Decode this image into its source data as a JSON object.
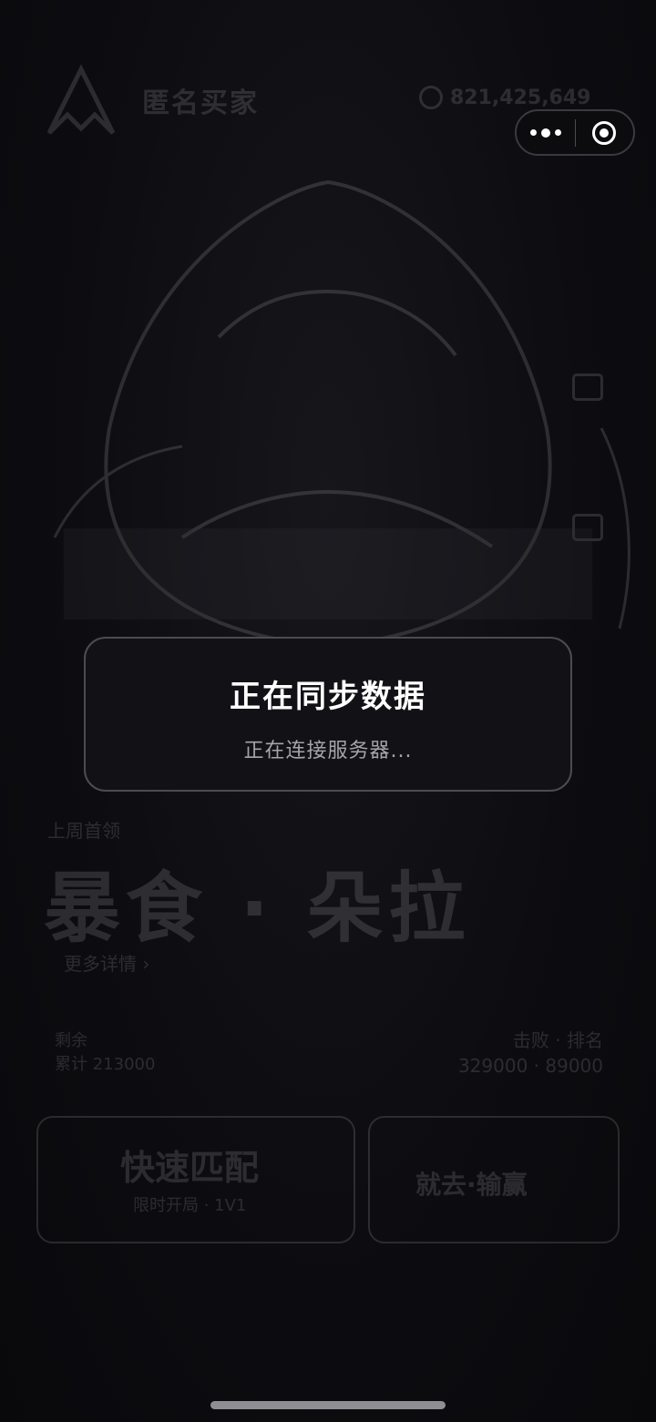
{
  "background": {
    "app_name": "匿名买家",
    "coin_amount": "821,425,649",
    "boss_label": "上周首领",
    "boss_title": "暴食 · 朵拉",
    "more_details": "更多详情  ›",
    "row_left_top": "剩余",
    "row_left_bottom": "累计 213000",
    "row_right_top": "击败 · 排名",
    "row_right_bottom": "329000 · 89000",
    "card_left_title": "快速匹配",
    "card_left_sub": "限时开局 · 1V1",
    "card_right_title": "就去·输赢"
  },
  "modal": {
    "title": "正在同步数据",
    "message": "正在连接服务器..."
  },
  "capsule": {
    "more_icon": "more-dots-icon",
    "close_icon": "target-close-icon"
  }
}
